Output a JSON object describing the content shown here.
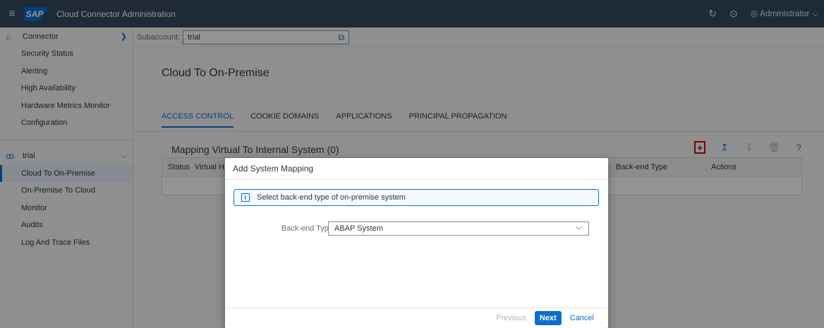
{
  "topbar": {
    "menu_icon": "hamburger-icon",
    "logo": "SAP",
    "title": "Cloud Connector Administration",
    "refresh_icon": "refresh-icon",
    "logout_icon": "logout-icon",
    "user_label": "Administrator",
    "user_icon": "user-icon",
    "chevron": "chevron-down-icon"
  },
  "sidebar": {
    "connector_group": {
      "label": "Connector",
      "icon": "home-icon",
      "items": [
        {
          "label": "Security Status"
        },
        {
          "label": "Alerting"
        },
        {
          "label": "High Availability"
        },
        {
          "label": "Hardware Metrics Monitor"
        },
        {
          "label": "Configuration"
        }
      ]
    },
    "subaccount_group": {
      "label": "trial",
      "icon": "group-icon",
      "items": [
        {
          "label": "Cloud To On-Premise",
          "selected": true
        },
        {
          "label": "On-Premise To Cloud"
        },
        {
          "label": "Monitor"
        },
        {
          "label": "Audits"
        },
        {
          "label": "Log And Trace Files"
        }
      ]
    }
  },
  "subaccount": {
    "label": "Subaccount:",
    "value": "trial"
  },
  "page": {
    "title": "Cloud To On-Premise",
    "tabs": [
      {
        "label": "ACCESS CONTROL",
        "active": true
      },
      {
        "label": "COOKIE DOMAINS"
      },
      {
        "label": "APPLICATIONS"
      },
      {
        "label": "PRINCIPAL PROPAGATION"
      }
    ]
  },
  "mapping": {
    "title": "Mapping Virtual To Internal System (0)",
    "columns": {
      "status": "Status",
      "virtual": "Virtual H",
      "backend_type": "Back-end Type",
      "actions": "Actions"
    },
    "toolbar": {
      "add_glyph": "+",
      "upload_glyph": "↥",
      "download_glyph": "↧",
      "delete_glyph": "🗑",
      "help_glyph": "?"
    }
  },
  "dialog": {
    "title": "Add System Mapping",
    "info_message": "Select back-end type of on-premise system",
    "backend_label": "Back-end Type:",
    "backend_value": "ABAP System",
    "previous_label": "Previous",
    "next_label": "Next",
    "cancel_label": "Cancel"
  },
  "colors": {
    "shell": "#354a5f",
    "accent": "#0a6ed1",
    "highlight": "#e00000"
  }
}
